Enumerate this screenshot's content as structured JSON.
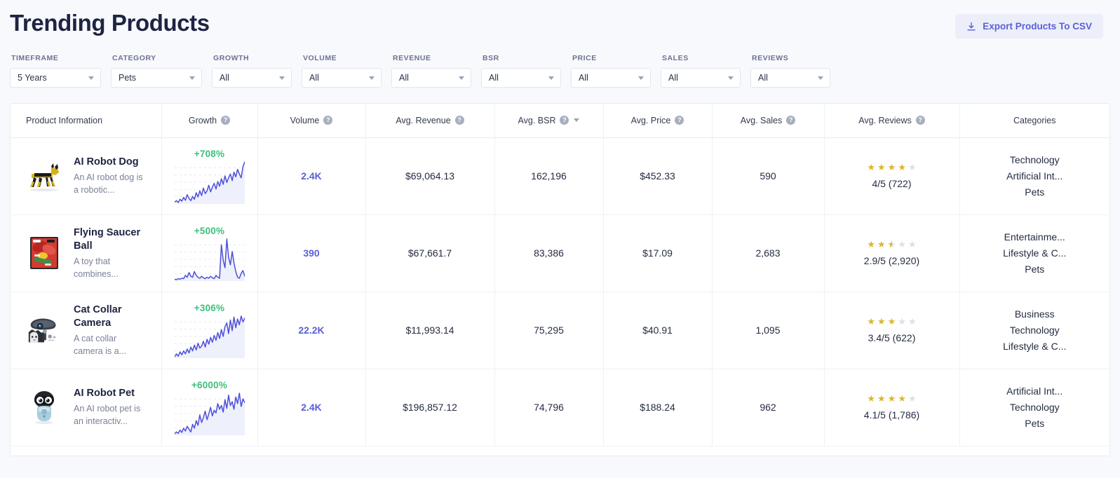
{
  "header": {
    "title": "Trending Products",
    "export_label": "Export Products To CSV"
  },
  "filters": [
    {
      "label": "TIMEFRAME",
      "value": "5 Years"
    },
    {
      "label": "CATEGORY",
      "value": "Pets"
    },
    {
      "label": "GROWTH",
      "value": "All"
    },
    {
      "label": "VOLUME",
      "value": "All"
    },
    {
      "label": "REVENUE",
      "value": "All"
    },
    {
      "label": "BSR",
      "value": "All"
    },
    {
      "label": "PRICE",
      "value": "All"
    },
    {
      "label": "SALES",
      "value": "All"
    },
    {
      "label": "REVIEWS",
      "value": "All"
    }
  ],
  "table": {
    "columns": [
      {
        "label": "Product Information",
        "help": false,
        "sorted": false
      },
      {
        "label": "Growth",
        "help": true,
        "sorted": false
      },
      {
        "label": "Volume",
        "help": true,
        "sorted": false
      },
      {
        "label": "Avg. Revenue",
        "help": true,
        "sorted": false
      },
      {
        "label": "Avg. BSR",
        "help": true,
        "sorted": true
      },
      {
        "label": "Avg. Price",
        "help": true,
        "sorted": false
      },
      {
        "label": "Avg. Sales",
        "help": true,
        "sorted": false
      },
      {
        "label": "Avg. Reviews",
        "help": true,
        "sorted": false
      },
      {
        "label": "Categories",
        "help": false,
        "sorted": false
      }
    ],
    "rows": [
      {
        "name": "AI Robot Dog",
        "description": "An AI robot dog is a robotic...",
        "thumb": "robot-dog-thumbnail",
        "growth": "+708%",
        "volume": "2.4K",
        "revenue": "$69,064.13",
        "bsr": "162,196",
        "price": "$452.33",
        "sales": "590",
        "rating_text": "4/5 (722)",
        "rating_value": 4,
        "categories": [
          "Technology",
          "Artificial Int...",
          "Pets"
        ]
      },
      {
        "name": "Flying Saucer Ball",
        "description": "A toy that combines...",
        "thumb": "flying-saucer-ball-thumbnail",
        "growth": "+500%",
        "volume": "390",
        "revenue": "$67,661.7",
        "bsr": "83,386",
        "price": "$17.09",
        "sales": "2,683",
        "rating_text": "2.9/5 (2,920)",
        "rating_value": 2.5,
        "categories": [
          "Entertainme...",
          "Lifestyle & C...",
          "Pets"
        ]
      },
      {
        "name": "Cat Collar Camera",
        "description": "A cat collar camera is a...",
        "thumb": "cat-collar-camera-thumbnail",
        "growth": "+306%",
        "volume": "22.2K",
        "revenue": "$11,993.14",
        "bsr": "75,295",
        "price": "$40.91",
        "sales": "1,095",
        "rating_text": "3.4/5 (622)",
        "rating_value": 3,
        "categories": [
          "Business",
          "Technology",
          "Lifestyle & C..."
        ]
      },
      {
        "name": "AI Robot Pet",
        "description": "An AI robot pet is an interactiv...",
        "thumb": "robot-pet-thumbnail",
        "growth": "+6000%",
        "volume": "2.4K",
        "revenue": "$196,857.12",
        "bsr": "74,796",
        "price": "$188.24",
        "sales": "962",
        "rating_text": "4.1/5 (1,786)",
        "rating_value": 4,
        "categories": [
          "Artificial Int...",
          "Technology",
          "Pets"
        ]
      }
    ]
  },
  "chart_data": [
    {
      "type": "line",
      "title": "AI Robot Dog search volume trend",
      "series": [
        {
          "name": "volume",
          "values": [
            6,
            9,
            5,
            12,
            8,
            16,
            10,
            22,
            14,
            9,
            18,
            12,
            26,
            17,
            30,
            20,
            36,
            24,
            30,
            42,
            28,
            38,
            46,
            34,
            50,
            40,
            56,
            44,
            62,
            48,
            58,
            66,
            52,
            70,
            60,
            76,
            66,
            58,
            82,
            92
          ]
        }
      ],
      "ylabel": "",
      "xlabel": "",
      "grid": true,
      "legend": "none"
    },
    {
      "type": "line",
      "title": "Flying Saucer Ball search volume trend",
      "series": [
        {
          "name": "volume",
          "values": [
            6,
            5,
            7,
            6,
            8,
            7,
            14,
            10,
            20,
            12,
            10,
            22,
            14,
            10,
            8,
            12,
            9,
            7,
            10,
            8,
            12,
            9,
            7,
            14,
            10,
            8,
            78,
            46,
            30,
            90,
            52,
            36,
            64,
            40,
            22,
            10,
            8,
            18,
            24,
            12
          ]
        }
      ],
      "ylabel": "",
      "xlabel": "",
      "grid": true,
      "legend": "none"
    },
    {
      "type": "line",
      "title": "Cat Collar Camera search volume trend",
      "series": [
        {
          "name": "volume",
          "values": [
            8,
            14,
            9,
            18,
            12,
            20,
            14,
            24,
            16,
            28,
            20,
            32,
            22,
            36,
            26,
            30,
            40,
            28,
            44,
            34,
            48,
            38,
            52,
            42,
            58,
            46,
            64,
            50,
            70,
            78,
            56,
            84,
            62,
            90,
            68,
            86,
            74,
            92,
            80,
            88
          ]
        }
      ],
      "ylabel": "",
      "xlabel": "",
      "grid": true,
      "legend": "none"
    },
    {
      "type": "line",
      "title": "AI Robot Pet search volume trend",
      "series": [
        {
          "name": "volume",
          "values": [
            6,
            10,
            7,
            14,
            9,
            18,
            12,
            22,
            16,
            10,
            26,
            18,
            34,
            24,
            46,
            30,
            40,
            54,
            36,
            48,
            62,
            44,
            56,
            50,
            70,
            58,
            66,
            52,
            78,
            60,
            88,
            66,
            74,
            58,
            84,
            70,
            92,
            64,
            80,
            72
          ]
        }
      ],
      "ylabel": "",
      "xlabel": "",
      "grid": true,
      "legend": "none"
    }
  ],
  "colors": {
    "accent": "#5a5fd6",
    "growth_green": "#3dbf7b",
    "star_gold": "#ddb52c",
    "page_bg": "#f7f9fd",
    "panel_bg": "#ffffff"
  }
}
